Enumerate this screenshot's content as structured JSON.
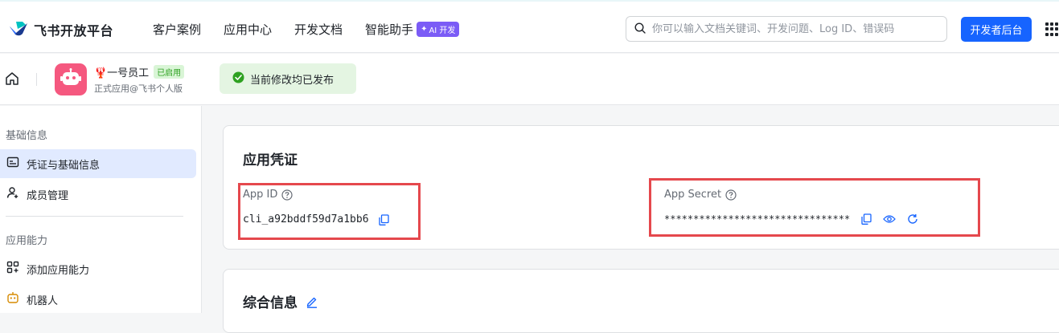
{
  "header": {
    "brand": "飞书开放平台",
    "nav": [
      {
        "label": "客户案例"
      },
      {
        "label": "应用中心"
      },
      {
        "label": "开发文档"
      },
      {
        "label": "智能助手",
        "badge": "AI 开发"
      }
    ],
    "search_placeholder": "你可以输入文档关键词、开发问题、Log ID、错误码",
    "console_button": "开发者后台"
  },
  "app": {
    "name": "🦞一号员工",
    "status_tag": "已启用",
    "subtitle": "正式应用@飞书个人版",
    "publish_status": "当前修改均已发布"
  },
  "sidebar": {
    "sections": [
      {
        "title": "基础信息",
        "items": [
          {
            "label": "凭证与基础信息",
            "icon": "credential-icon",
            "active": true
          },
          {
            "label": "成员管理",
            "icon": "member-icon",
            "active": false
          }
        ]
      },
      {
        "title": "应用能力",
        "items": [
          {
            "label": "添加应用能力",
            "icon": "capability-icon",
            "active": false
          },
          {
            "label": "机器人",
            "icon": "robot-icon",
            "active": false
          }
        ]
      }
    ]
  },
  "credentials": {
    "title": "应用凭证",
    "app_id_label": "App ID",
    "app_id_value": "cli_a92bddf59d7a1bb6",
    "app_secret_label": "App Secret",
    "app_secret_value": "********************************"
  },
  "general": {
    "title": "综合信息"
  },
  "colors": {
    "accent": "#1664ff",
    "highlight_box": "#e5484d",
    "publish_bg": "#e4f5e2",
    "ai_badge": "#7b5cf6"
  }
}
